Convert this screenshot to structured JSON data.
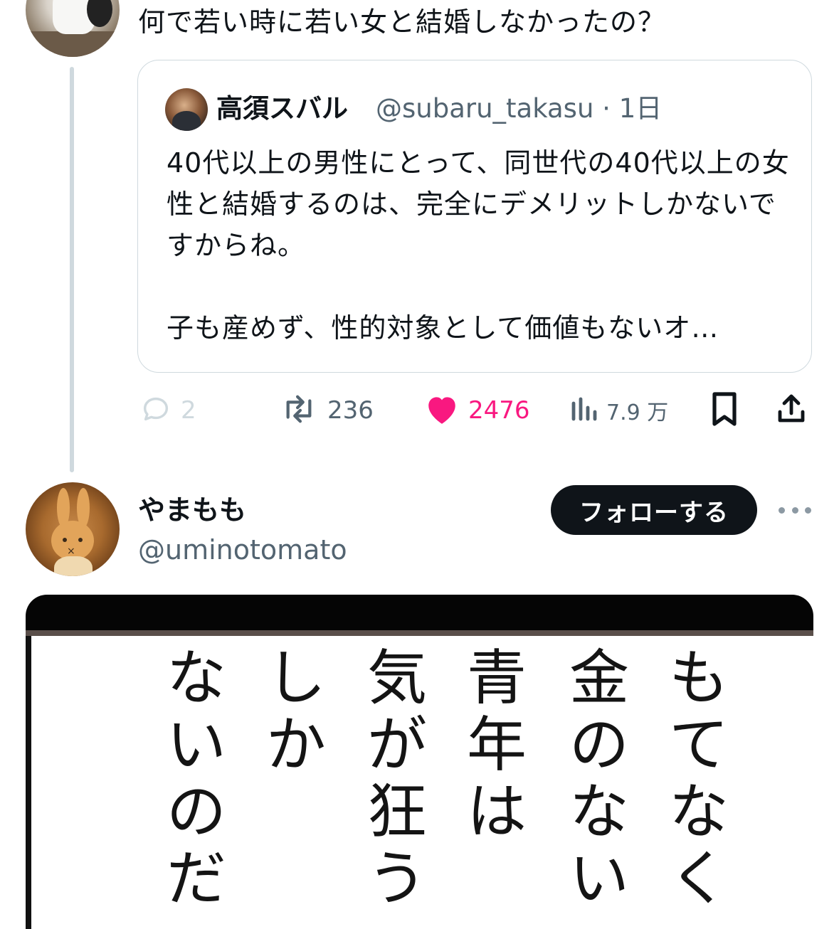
{
  "reply_tweet": {
    "text": "何で若い時に若い女と結婚しなかったの？"
  },
  "quoted_tweet": {
    "name": "高須スバル",
    "handle_time": "@subaru_takasu · 1日",
    "body": "40代以上の男性にとって、同世代の40代以上の女性と結婚するのは、完全にデメリットしかないですからね。\n\n子も産めず、性的対象として価値もないオ…"
  },
  "actions": {
    "replies": "2",
    "retweets": "236",
    "likes": "2476",
    "views": "7.9 万",
    "icons": {
      "reply": "reply-bubble-icon",
      "retweet": "retweet-icon",
      "like": "heart-icon",
      "views": "views-bars-icon",
      "bookmark": "bookmark-icon",
      "share": "share-icon"
    },
    "colors": {
      "like": "#f91880",
      "muted": "#536471"
    }
  },
  "next_tweet": {
    "name": "やまもも",
    "handle": "@uminotomato",
    "follow_label": "フォローする",
    "media_columns": [
      "もてなく",
      "金のない",
      "青年は",
      "気が狂う",
      "しか",
      "ないのだ"
    ]
  }
}
